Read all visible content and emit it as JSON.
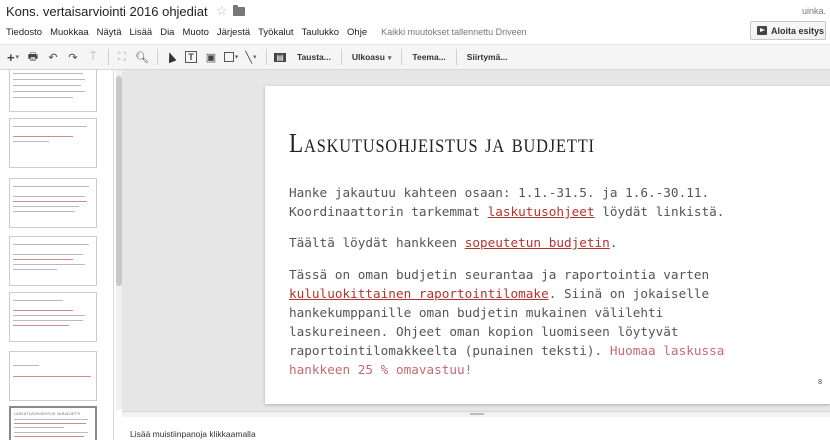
{
  "header": {
    "doc_title": "Kons. vertaisarviointi 2016 ohjediat",
    "user": "uinka.",
    "present_label": "Aloita esitys"
  },
  "menu": {
    "items": [
      "Tiedosto",
      "Muokkaa",
      "Näytä",
      "Lisää",
      "Dia",
      "Muoto",
      "Järjestä",
      "Työkalut",
      "Taulukko",
      "Ohje"
    ],
    "save_status": "Kaikki muutokset tallennettu Driveen"
  },
  "toolbar": {
    "icons": [
      "plus-icon",
      "undo-icon",
      "redo-icon",
      "print-icon",
      "paint-format-icon",
      "zoom-icon"
    ],
    "background_label": "Tausta...",
    "layout_label": "Ulkoasu",
    "theme_label": "Teema...",
    "transition_label": "Siirtymä..."
  },
  "slide": {
    "title": "Laskutusohjeistus ja budjetti",
    "p1_line1": "Hanke jakautuu kahteen osaan: 1.1.-31.5. ja 1.6.-30.11.",
    "p1_line2_a": "Koordinaattorin tarkemmat ",
    "p1_line2_link": "laskutusohjeet",
    "p1_line2_b": " löydät linkistä.",
    "p2_a": "Täältä löydät hankkeen ",
    "p2_link": "sopeutetun budjetin",
    "p2_b": ".",
    "p3_line1": "Tässä on oman budjetin seurantaa ja raportointia varten",
    "p3_line2_link": "kululuokittainen raportointilomake",
    "p3_line2_b": ". Siinä on jokaiselle",
    "p3_line3": "hankekumppanille oman budjetin mukainen välilehti",
    "p3_line4": "laskureineen. Ohjeet oman kopion luomiseen löytyvät",
    "p3_line5_a": "raportointilomakkeelta (punainen teksti). ",
    "p3_line5_warn": "Huomaa laskussa",
    "p3_line6_warn": "hankkeen 25 % omavastuu!",
    "number": "8"
  },
  "filmstrip": {
    "thumb_titles": [
      "",
      "",
      "",
      "",
      "",
      "",
      "",
      "LASKUTUSOHJEISTUS JA BUDJETTI"
    ]
  },
  "notes": {
    "placeholder": "Lisää muistiinpanoja klikkaamalla"
  }
}
